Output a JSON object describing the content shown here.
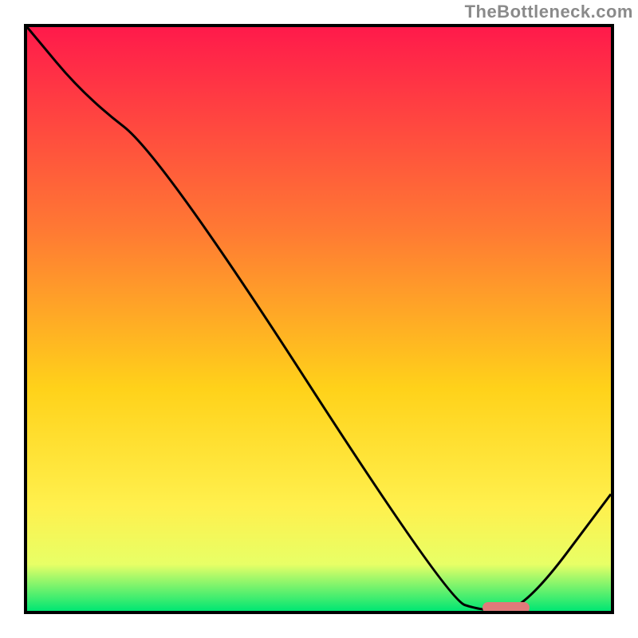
{
  "watermark": "TheBottleneck.com",
  "colors": {
    "top": "#ff1a4b",
    "mid1": "#ff7a33",
    "mid2": "#ffd21a",
    "mid3": "#fff04d",
    "mid4": "#e8ff66",
    "bottom": "#00e673",
    "curve": "#000000",
    "marker": "#e07a7a",
    "frame": "#000000"
  },
  "chart_data": {
    "type": "line",
    "title": "",
    "xlabel": "",
    "ylabel": "",
    "xlim": [
      0,
      100
    ],
    "ylim": [
      0,
      100
    ],
    "grid": false,
    "series": [
      {
        "name": "bottleneck-curve",
        "x": [
          0,
          10,
          23,
          72,
          78,
          85,
          100
        ],
        "values": [
          100,
          88,
          78,
          2,
          0,
          0,
          20
        ]
      }
    ],
    "marker": {
      "x_start": 78,
      "x_end": 86,
      "y": 0
    },
    "gradient_stops": [
      {
        "pos": 0.0,
        "color": "#ff1a4b"
      },
      {
        "pos": 0.35,
        "color": "#ff7a33"
      },
      {
        "pos": 0.62,
        "color": "#ffd21a"
      },
      {
        "pos": 0.82,
        "color": "#fff04d"
      },
      {
        "pos": 0.92,
        "color": "#e8ff66"
      },
      {
        "pos": 1.0,
        "color": "#00e673"
      }
    ]
  }
}
